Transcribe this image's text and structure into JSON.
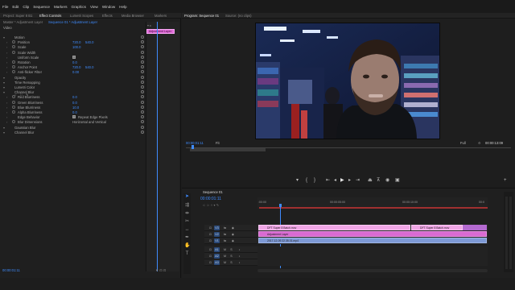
{
  "menu": [
    "File",
    "Edit",
    "Clip",
    "Sequence",
    "Markers",
    "Graphics",
    "View",
    "Window",
    "Help"
  ],
  "left_tabs": {
    "project": "Project: Super 8 B1",
    "effect_controls": "Effect Controls",
    "lumetri_scopes": "Lumetri Scopes",
    "effects": "Effects",
    "media_browser": "Media Browser",
    "markers": "Markers"
  },
  "right_tabs": {
    "program": "Program: Sequence 01",
    "source": "Source: (no clips)"
  },
  "ec": {
    "source_label": "Master * Adjustment Layer",
    "sequence_label": "Sequence 01 * Adjustment Layer",
    "video_header": "Video",
    "clip_label": "Adjustment Layer",
    "rows": [
      {
        "label": "Motion"
      },
      {
        "label": "Position",
        "value": "720.0",
        "value2": "540.0"
      },
      {
        "label": "Scale",
        "value": "100.0"
      },
      {
        "label": "Scale Width",
        "value": ""
      },
      {
        "label": "Uniform Scale",
        "value": "",
        "check": true
      },
      {
        "label": "Rotation",
        "value": "0.0"
      },
      {
        "label": "Anchor Point",
        "value": "720.0",
        "value2": "540.0"
      },
      {
        "label": "Anti-flicker Filter",
        "value": "0.00"
      },
      {
        "label": "Opacity"
      },
      {
        "label": "Time Remapping"
      },
      {
        "label": "Lumetri Color"
      },
      {
        "label": "Channel Blur"
      },
      {
        "label": "Red Blurriness",
        "value": "0.0"
      },
      {
        "label": "Green Blurriness",
        "value": "0.0"
      },
      {
        "label": "Blue Blurriness",
        "value": "10.0"
      },
      {
        "label": "Alpha Blurriness",
        "value": "0.0"
      },
      {
        "label": "Edge Behavior",
        "value": "",
        "check": true,
        "check_label": "Repeat Edge Pixels"
      },
      {
        "label": "Blur Dimensions",
        "value": "Horizontal and Vertical"
      },
      {
        "label": "Gaussian Blur"
      },
      {
        "label": "Channel Blur"
      }
    ],
    "timecode": "00:00:01:11"
  },
  "program": {
    "timecode": "00:00:01:11",
    "fit": "Fit",
    "full": "Full",
    "duration": "00:00:13:09"
  },
  "timeline": {
    "tab": "Sequence 01",
    "timecode": "00:00:01:11",
    "ruler": [
      ":00:00",
      "00:00:05:00",
      "00:00:10:00",
      "00:0"
    ],
    "tracks": [
      "V3",
      "V2",
      "V1",
      "A1",
      "A2",
      "A3"
    ],
    "clips": {
      "v3a": "DFT Super 8 Batch.mov",
      "v3b": "DFT Super 8 Batch.mov",
      "v2": "Adjustment Layer",
      "v1": "2017-12-09 22.35.01.mp4"
    }
  },
  "colors": {
    "accent": "#3f8cff",
    "adjustment": "#e06cd8",
    "clip_pink": "#f0a6e6",
    "clip_blue": "#7e9ad6",
    "playhead": "#3f8cff"
  }
}
